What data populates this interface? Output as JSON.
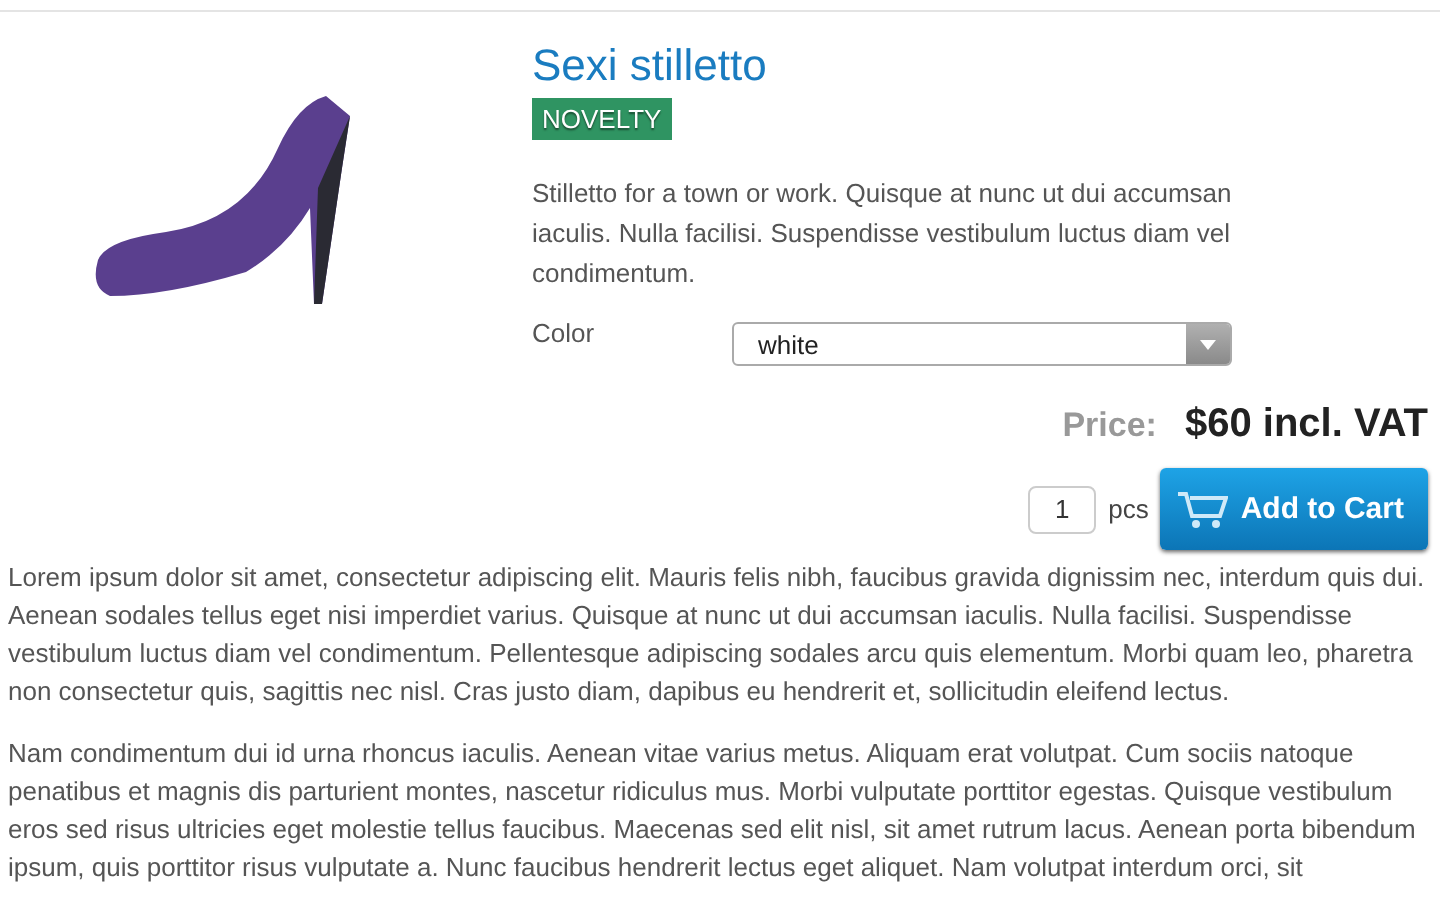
{
  "product": {
    "title": "Sexi stilletto",
    "badge": "NOVELTY",
    "description": "Stilletto for a town or work. Quisque at nunc ut dui accumsan iaculis. Nulla facilisi. Suspendisse vestibulum luctus diam vel condimentum.",
    "option": {
      "label": "Color",
      "value": "white"
    },
    "price": {
      "label": "Price:",
      "value": "$60 incl. VAT"
    },
    "quantity": {
      "value": "1",
      "unit": "pcs"
    },
    "add_button": "Add to Cart"
  },
  "paragraphs": [
    "Lorem ipsum dolor sit amet, consectetur adipiscing elit. Mauris felis nibh, faucibus gravida dignissim nec, interdum quis dui. Aenean sodales tellus eget nisi imperdiet varius. Quisque at nunc ut dui accumsan iaculis. Nulla facilisi. Suspendisse vestibulum luctus diam vel condimentum. Pellentesque adipiscing sodales arcu quis elementum. Morbi quam leo, pharetra non consectetur quis, sagittis nec nisl. Cras justo diam, dapibus eu hendrerit et, sollicitudin eleifend lectus.",
    "Nam condimentum dui id urna rhoncus iaculis. Aenean vitae varius metus. Aliquam erat volutpat. Cum sociis natoque penatibus et magnis dis parturient montes, nascetur ridiculus mus. Morbi vulputate porttitor egestas. Quisque vestibulum eros sed risus ultricies eget molestie tellus faucibus. Maecenas sed elit nisl, sit amet rutrum lacus. Aenean porta bibendum ipsum, quis porttitor risus vulputate a. Nunc faucibus hendrerit lectus eget aliquet. Nam volutpat interdum orci, sit"
  ]
}
